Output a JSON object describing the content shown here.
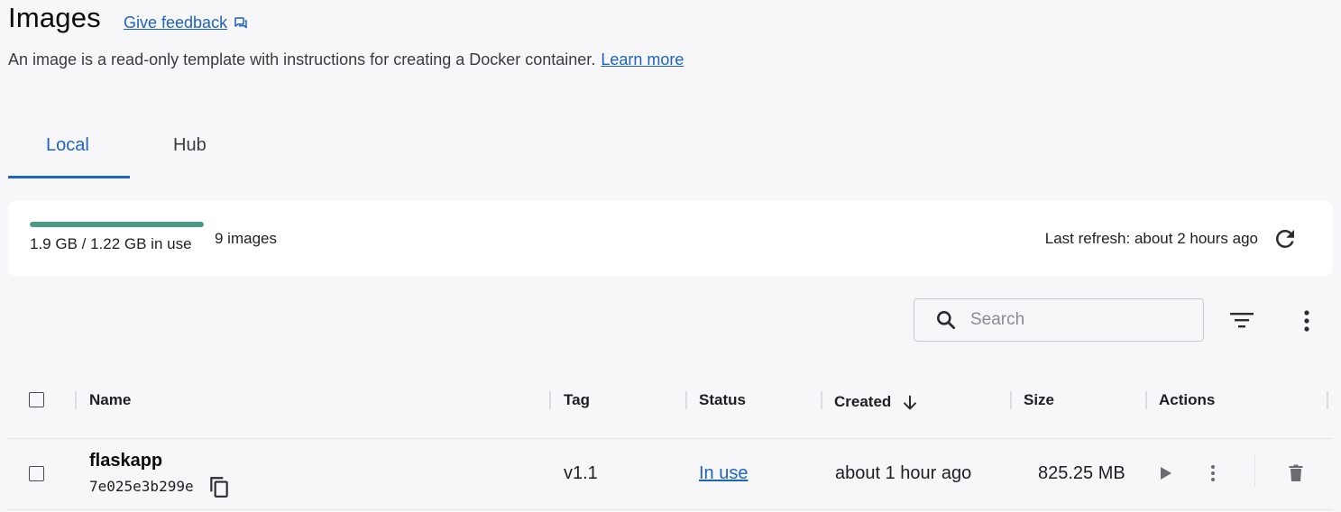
{
  "header": {
    "title": "Images",
    "feedback_label": "Give feedback",
    "subtitle": "An image is a read-only template with instructions for creating a Docker container.",
    "learn_more_label": "Learn more"
  },
  "tabs": [
    {
      "label": "Local",
      "active": true
    },
    {
      "label": "Hub",
      "active": false
    }
  ],
  "summary": {
    "usage_text": "1.9 GB / 1.22 GB in use",
    "usage_fraction": 1.0,
    "image_count": "9 images",
    "last_refresh": "Last refresh: about 2 hours ago"
  },
  "toolbar": {
    "search_placeholder": "Search",
    "search_value": ""
  },
  "table": {
    "headers": {
      "name": "Name",
      "tag": "Tag",
      "status": "Status",
      "created": "Created",
      "size": "Size",
      "actions": "Actions"
    },
    "sort": {
      "column": "created",
      "direction": "descending"
    },
    "rows": [
      {
        "name": "flaskapp",
        "id": "7e025e3b299e",
        "tag": "v1.1",
        "status": "In use",
        "created": "about 1 hour ago",
        "size": "825.25 MB"
      }
    ]
  },
  "colors": {
    "accent": "#1d63c4",
    "usage_bar": "#4a9b86",
    "background": "#f7f7f9",
    "card": "#ffffff"
  },
  "icons": {
    "feedback": "chat-bubbles-icon",
    "refresh": "refresh-icon",
    "search": "search-icon",
    "filter": "filter-icon",
    "more": "more-vertical-icon",
    "sort": "arrow-down-icon",
    "copy": "copy-icon",
    "run": "play-icon",
    "delete": "trash-icon"
  }
}
